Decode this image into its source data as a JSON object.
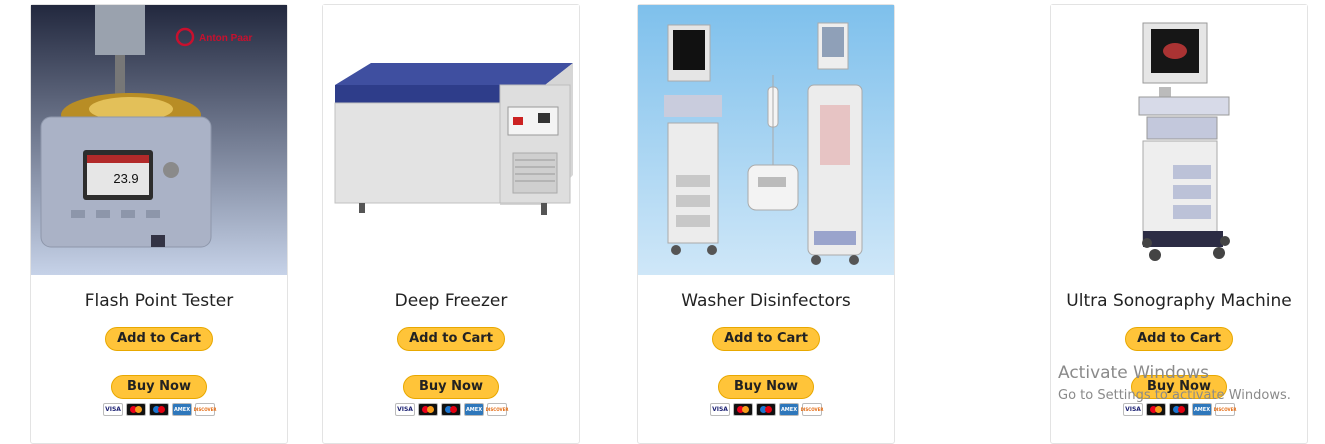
{
  "products": [
    {
      "title": "Flash Point Tester",
      "brand": "Anton Paar",
      "display_value": "23.9"
    },
    {
      "title": "Deep Freezer"
    },
    {
      "title": "Washer Disinfectors"
    },
    {
      "title": "Ultra Sonography Machine"
    }
  ],
  "buttons": {
    "add_to_cart": "Add to Cart",
    "buy_now": "Buy Now"
  },
  "payment_cards": [
    "VISA",
    "mastercard",
    "maestro",
    "AMERICAN EXPRESS",
    "DISCOVER"
  ],
  "watermark": {
    "line1": "Activate Windows",
    "line2": "Go to Settings to activate Windows."
  },
  "colors": {
    "button": "#ffc439",
    "border": "#e3e3e3"
  }
}
